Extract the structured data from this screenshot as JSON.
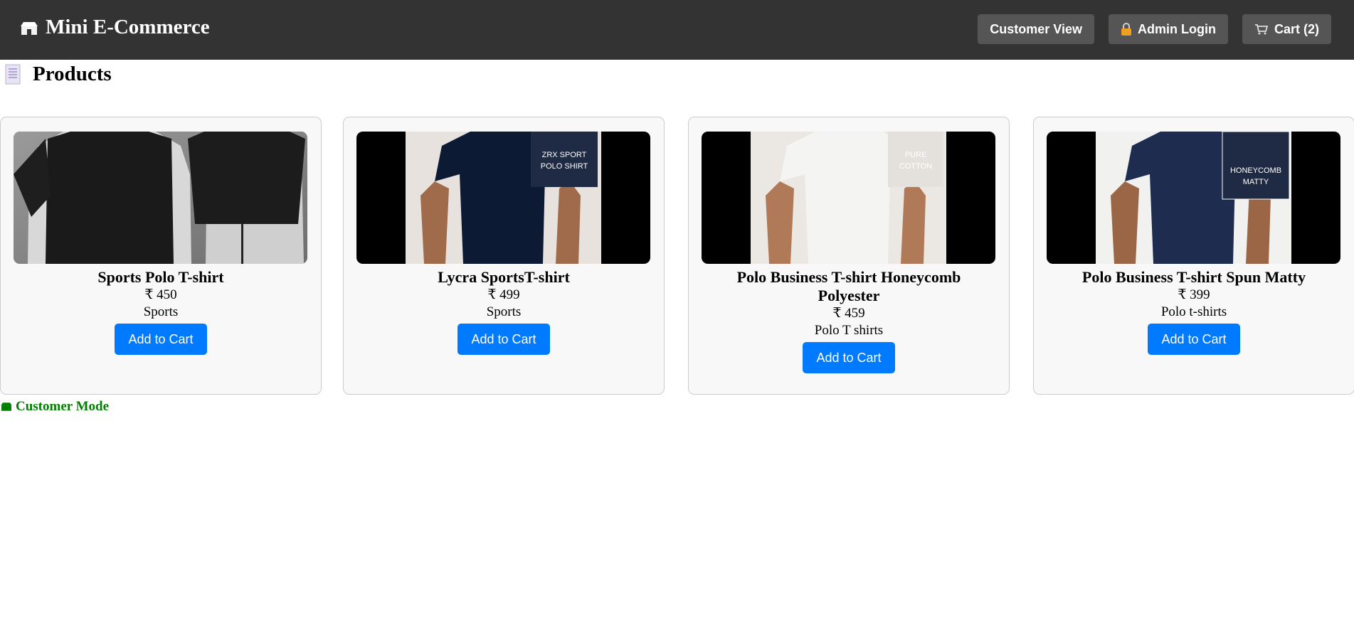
{
  "header": {
    "title": "Mini E-Commerce",
    "brand_icon": "store-icon",
    "nav": {
      "customer_view": "Customer View",
      "admin_login": "Admin Login",
      "cart": "Cart (2)"
    }
  },
  "section": {
    "title": "Products",
    "icon": "document-icon"
  },
  "products": [
    {
      "name": "Sports Polo T-shirt",
      "price": "₹ 450",
      "category": "Sports",
      "button": "Add to Cart",
      "image": "black-tshirt-mannequins"
    },
    {
      "name": "Lycra SportsT-shirt",
      "price": "₹ 499",
      "category": "Sports",
      "button": "Add to Cart",
      "image": "navy-polo-shirt",
      "image_label_1": "ZRX SPORT",
      "image_label_2": "POLO SHIRT"
    },
    {
      "name": "Polo Business T-shirt Honeycomb Polyester",
      "price": "₹ 459",
      "category": "Polo T shirts",
      "button": "Add to Cart",
      "image": "white-polo-shirt",
      "image_label_1": "PURE",
      "image_label_2": "COTTON"
    },
    {
      "name": "Polo Business T-shirt Spun Matty",
      "price": "₹ 399",
      "category": "Polo t-shirts",
      "button": "Add to Cart",
      "image": "navy-polo-shirt",
      "image_label_1": "HONEYCOMB",
      "image_label_2": "MATTY"
    }
  ],
  "footer": {
    "mode": "Customer Mode"
  },
  "colors": {
    "header_bg": "#333333",
    "nav_btn_bg": "#555555",
    "primary": "#007bff",
    "mode_text": "#008000"
  }
}
